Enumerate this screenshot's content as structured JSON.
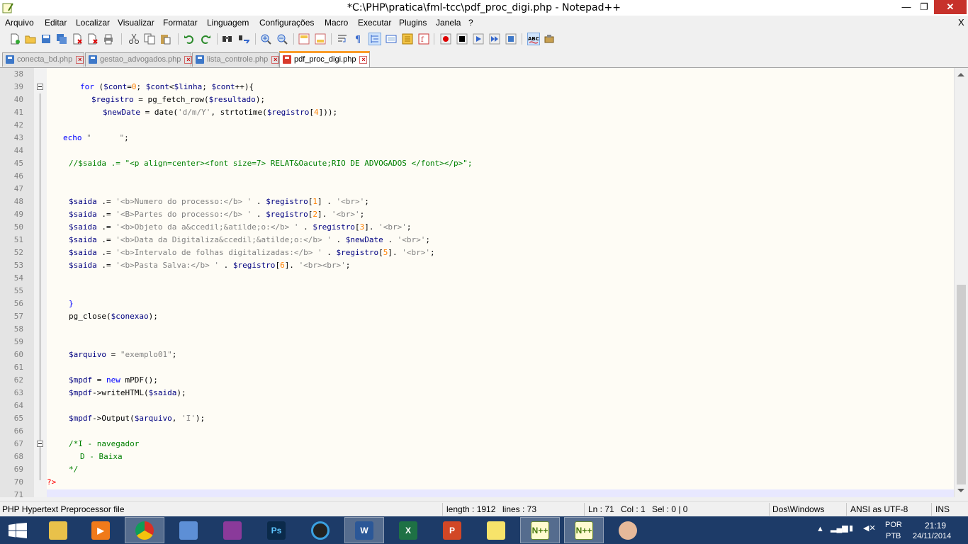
{
  "window": {
    "title": "*C:\\PHP\\pratica\\fml-tcc\\pdf_proc_digi.php - Notepad++"
  },
  "menu": [
    "Arquivo",
    "Editar",
    "Localizar",
    "Visualizar",
    "Formatar",
    "Linguagem",
    "Configurações",
    "Macro",
    "Executar",
    "Plugins",
    "Janela",
    "?"
  ],
  "menu_close": "X",
  "tabs": [
    {
      "label": "conecta_bd.php",
      "active": false
    },
    {
      "label": "gestao_advogados.php",
      "active": false
    },
    {
      "label": "lista_controle.php",
      "active": false
    },
    {
      "label": "pdf_proc_digi.php",
      "active": true
    }
  ],
  "toolbar_icons": [
    "new-file-icon",
    "open-file-icon",
    "save-icon",
    "save-all-icon",
    "close-icon",
    "close-all-icon",
    "print-icon",
    "cut-icon",
    "copy-icon",
    "paste-icon",
    "undo-icon",
    "redo-icon",
    "find-icon",
    "replace-icon",
    "zoom-in-icon",
    "zoom-out-icon",
    "sync-vertical-icon",
    "sync-horizontal-icon",
    "word-wrap-icon",
    "show-all-chars-icon",
    "indent-guide-icon",
    "user-lang-icon",
    "doc-map-icon",
    "function-list-icon",
    "record-macro-icon",
    "stop-macro-icon",
    "play-macro-icon",
    "run-macro-multiple-icon",
    "save-macro-icon",
    "spell-check-icon",
    "plugin-icon"
  ],
  "code_lines": [
    {
      "n": "38",
      "text": ""
    },
    {
      "n": "39",
      "text": "for ($cont=0; $cont<$linha; $cont++){"
    },
    {
      "n": "40",
      "text": "$registro = pg_fetch_row($resultado);"
    },
    {
      "n": "41",
      "text": "$newDate = date('d/m/Y', strtotime($registro[4]));"
    },
    {
      "n": "42",
      "text": ""
    },
    {
      "n": "43",
      "text": "echo \"      \";"
    },
    {
      "n": "44",
      "text": ""
    },
    {
      "n": "45",
      "text": "//$saida .= \"<p align=center><font size=7> RELAT&Oacute;RIO DE ADVOGADOS </font></p>\";"
    },
    {
      "n": "46",
      "text": ""
    },
    {
      "n": "47",
      "text": ""
    },
    {
      "n": "48",
      "text": "$saida .= '<b>Numero do processo:</b> ' . $registro[1] . '<br>';"
    },
    {
      "n": "49",
      "text": "$saida .= '<B>Partes do processo:</b> ' . $registro[2]. '<br>';"
    },
    {
      "n": "50",
      "text": "$saida .= '<b>Objeto da a&ccedil;&atilde;o:</b> ' . $registro[3]. '<br>';"
    },
    {
      "n": "51",
      "text": "$saida .= '<b>Data da Digitaliza&ccedil;&atilde;o:</b> ' . $newDate . '<br>';"
    },
    {
      "n": "52",
      "text": "$saida .= '<b>Intervalo de folhas digitalizadas:</b> ' . $registro[5]. '<br>';"
    },
    {
      "n": "53",
      "text": "$saida .= '<b>Pasta Salva:</b> ' . $registro[6]. '<br><br>';"
    },
    {
      "n": "54",
      "text": ""
    },
    {
      "n": "55",
      "text": ""
    },
    {
      "n": "56",
      "text": "}"
    },
    {
      "n": "57",
      "text": "pg_close($conexao);"
    },
    {
      "n": "58",
      "text": ""
    },
    {
      "n": "59",
      "text": ""
    },
    {
      "n": "60",
      "text": "$arquivo = \"exemplo01\";"
    },
    {
      "n": "61",
      "text": ""
    },
    {
      "n": "62",
      "text": "$mpdf = new mPDF();"
    },
    {
      "n": "63",
      "text": "$mpdf->writeHTML($saida);"
    },
    {
      "n": "64",
      "text": ""
    },
    {
      "n": "65",
      "text": "$mpdf->Output($arquivo, 'I');"
    },
    {
      "n": "66",
      "text": ""
    },
    {
      "n": "67",
      "text": "/*I - navegador"
    },
    {
      "n": "68",
      "text": "D - Baixa"
    },
    {
      "n": "69",
      "text": "*/"
    },
    {
      "n": "70",
      "text": "?>"
    },
    {
      "n": "71",
      "text": ""
    }
  ],
  "status": {
    "file_type": "PHP Hypertext Preprocessor file",
    "length": "length : 1912",
    "lines": "lines : 73",
    "ln": "Ln : 71",
    "col": "Col : 1",
    "sel": "Sel : 0 | 0",
    "eol": "Dos\\Windows",
    "encoding": "ANSI as UTF-8",
    "mode": "INS"
  },
  "taskbar": {
    "apps": [
      "file-explorer",
      "media-player",
      "chrome",
      "tablet-app",
      "winrar",
      "photoshop",
      "media-center",
      "word",
      "excel",
      "powerpoint",
      "sticky-notes",
      "notepadpp",
      "notepadpp-2",
      "paint"
    ],
    "lang": "POR",
    "kbd": "PTB",
    "time": "21:19",
    "date": "24/11/2014"
  },
  "colors": {
    "keyword": "#0000ff",
    "variable": "#000080",
    "string": "#808080",
    "comment": "#008000",
    "number": "#ff8000",
    "php_tag": "#ff0000"
  }
}
